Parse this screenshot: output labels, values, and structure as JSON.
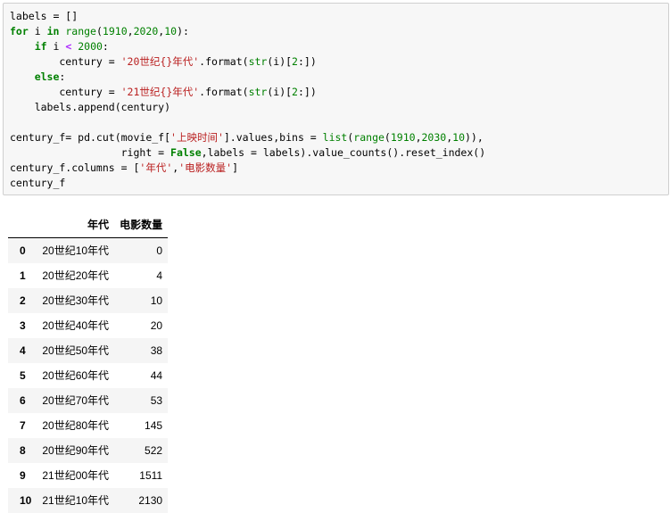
{
  "code_cell": {
    "lines": [
      [
        {
          "t": "labels = []"
        }
      ],
      [
        {
          "t": "for",
          "c": "kw"
        },
        {
          "t": " i "
        },
        {
          "t": "in",
          "c": "kw"
        },
        {
          "t": " "
        },
        {
          "t": "range",
          "c": "bi"
        },
        {
          "t": "("
        },
        {
          "t": "1910",
          "c": "num"
        },
        {
          "t": ","
        },
        {
          "t": "2020",
          "c": "num"
        },
        {
          "t": ","
        },
        {
          "t": "10",
          "c": "num"
        },
        {
          "t": "):"
        }
      ],
      [
        {
          "t": "    "
        },
        {
          "t": "if",
          "c": "kw"
        },
        {
          "t": " i "
        },
        {
          "t": "<",
          "c": "op"
        },
        {
          "t": " "
        },
        {
          "t": "2000",
          "c": "num"
        },
        {
          "t": ":"
        }
      ],
      [
        {
          "t": "        century = "
        },
        {
          "t": "'20世纪{}年代'",
          "c": "str"
        },
        {
          "t": ".format("
        },
        {
          "t": "str",
          "c": "bi"
        },
        {
          "t": "(i)["
        },
        {
          "t": "2",
          "c": "num"
        },
        {
          "t": ":])"
        }
      ],
      [
        {
          "t": "    "
        },
        {
          "t": "else",
          "c": "kw"
        },
        {
          "t": ":"
        }
      ],
      [
        {
          "t": "        century = "
        },
        {
          "t": "'21世纪{}年代'",
          "c": "str"
        },
        {
          "t": ".format("
        },
        {
          "t": "str",
          "c": "bi"
        },
        {
          "t": "(i)["
        },
        {
          "t": "2",
          "c": "num"
        },
        {
          "t": ":])"
        }
      ],
      [
        {
          "t": "    labels.append(century)"
        }
      ],
      [
        {
          "t": ""
        }
      ],
      [
        {
          "t": "century_f= pd.cut(movie_f["
        },
        {
          "t": "'上映时间'",
          "c": "str"
        },
        {
          "t": "].values,bins = "
        },
        {
          "t": "list",
          "c": "bi"
        },
        {
          "t": "("
        },
        {
          "t": "range",
          "c": "bi"
        },
        {
          "t": "("
        },
        {
          "t": "1910",
          "c": "num"
        },
        {
          "t": ","
        },
        {
          "t": "2030",
          "c": "num"
        },
        {
          "t": ","
        },
        {
          "t": "10",
          "c": "num"
        },
        {
          "t": ")),"
        }
      ],
      [
        {
          "t": "                  right = "
        },
        {
          "t": "False",
          "c": "kw"
        },
        {
          "t": ",labels = labels).value_counts().reset_index()"
        }
      ],
      [
        {
          "t": "century_f.columns = ["
        },
        {
          "t": "'年代'",
          "c": "str"
        },
        {
          "t": ","
        },
        {
          "t": "'电影数量'",
          "c": "str"
        },
        {
          "t": "]"
        }
      ],
      [
        {
          "t": "century_f"
        }
      ]
    ]
  },
  "output_table": {
    "columns": [
      "",
      "年代",
      "电影数量"
    ],
    "rows": [
      {
        "index": "0",
        "decade": "20世纪10年代",
        "count": "0"
      },
      {
        "index": "1",
        "decade": "20世纪20年代",
        "count": "4"
      },
      {
        "index": "2",
        "decade": "20世纪30年代",
        "count": "10"
      },
      {
        "index": "3",
        "decade": "20世纪40年代",
        "count": "20"
      },
      {
        "index": "4",
        "decade": "20世纪50年代",
        "count": "38"
      },
      {
        "index": "5",
        "decade": "20世纪60年代",
        "count": "44"
      },
      {
        "index": "6",
        "decade": "20世纪70年代",
        "count": "53"
      },
      {
        "index": "7",
        "decade": "20世纪80年代",
        "count": "145"
      },
      {
        "index": "8",
        "decade": "20世纪90年代",
        "count": "522"
      },
      {
        "index": "9",
        "decade": "21世纪00年代",
        "count": "1511"
      },
      {
        "index": "10",
        "decade": "21世纪10年代",
        "count": "2130"
      }
    ]
  }
}
